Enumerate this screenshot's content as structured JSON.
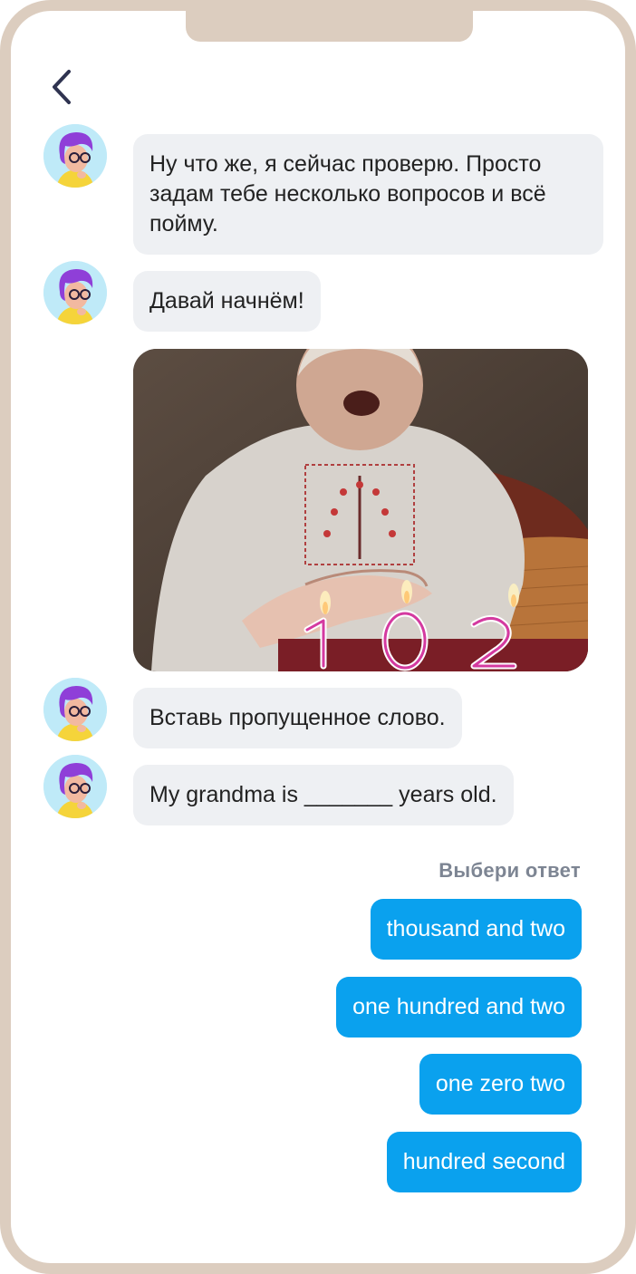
{
  "header": {
    "back_icon": "chevron-left-icon"
  },
  "messages": [
    {
      "text": "Ну что же, я сейчас проверю. Просто задам тебе несколько вопросов и всё пойму."
    },
    {
      "text": "Давай начнём!"
    },
    {
      "text": "Вставь пропущенное слово."
    },
    {
      "text": "My grandma is _______ years old."
    }
  ],
  "media": {
    "candles_text": "102"
  },
  "answers": {
    "prompt": "Выбери ответ",
    "options": [
      "thousand and two",
      "one hundred and two",
      "one zero two",
      "hundred second"
    ]
  },
  "colors": {
    "frame": "#dccdbf",
    "bubble_bg": "#eef0f3",
    "answer_bg": "#0aa1ee",
    "answer_text": "#ffffff",
    "avatar_bg": "#bfeaf8",
    "avatar_hair": "#8f3fd8"
  }
}
